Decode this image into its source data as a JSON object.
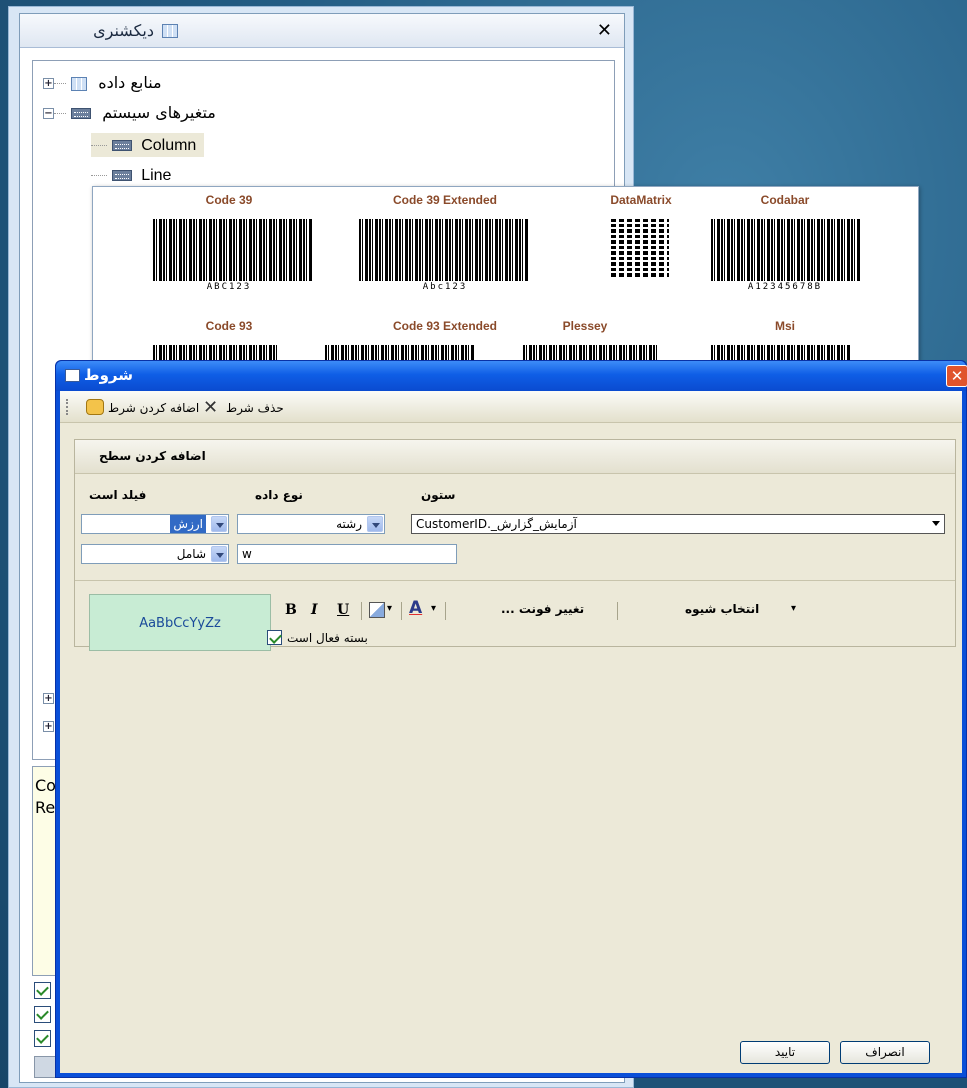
{
  "dictionary": {
    "title": "دیکشنری",
    "close_glyph": "✕",
    "tree": {
      "data_sources": "منابع داده",
      "system_vars": "متغیرهای سیستم",
      "column": "Column",
      "line": "Line"
    },
    "desc_lines": [
      "Co",
      "Re"
    ]
  },
  "barcodes": {
    "row1": [
      {
        "name": "Code 39",
        "text": "ABC123"
      },
      {
        "name": "Code 39 Extended",
        "text": "Abc123"
      },
      {
        "name": "DataMatrix",
        "text": ""
      },
      {
        "name": "Codabar",
        "text": "A12345678B"
      }
    ],
    "row2": [
      "Code 93",
      "Code 93 Extended",
      "Plessey",
      "Msi"
    ]
  },
  "dialog": {
    "title": "شروط",
    "close_glyph": "✕",
    "toolbar": {
      "add_condition": "اضافه کردن شرط",
      "remove_condition": "حذف شرط"
    },
    "panel_title": "اضافه کردن سطح",
    "labels": {
      "column": "ستون",
      "data_type": "نوع داده",
      "field_is": "فیلد است"
    },
    "column_value": "آزمایش_گزارش_.CustomerID",
    "data_type_value": "رشته",
    "field_value": "ارزش",
    "operator_value": "شامل",
    "input_value": "w",
    "style_preview": "AaBbCcYyZz",
    "bold": "B",
    "italic": "I",
    "underline": "U",
    "font_color_letter": "A",
    "change_font": "تغییر فونت ...",
    "choose_style": "انتخاب شیوه",
    "enabled_label": "بسته فعال است",
    "ok": "تایید",
    "cancel": "انصراف"
  },
  "colors": {
    "title_bar": "#0a4fd8",
    "dialog_body": "#ece9d8",
    "preview_bg": "#c8ecd4",
    "barcode_label": "#8a4a2a"
  }
}
